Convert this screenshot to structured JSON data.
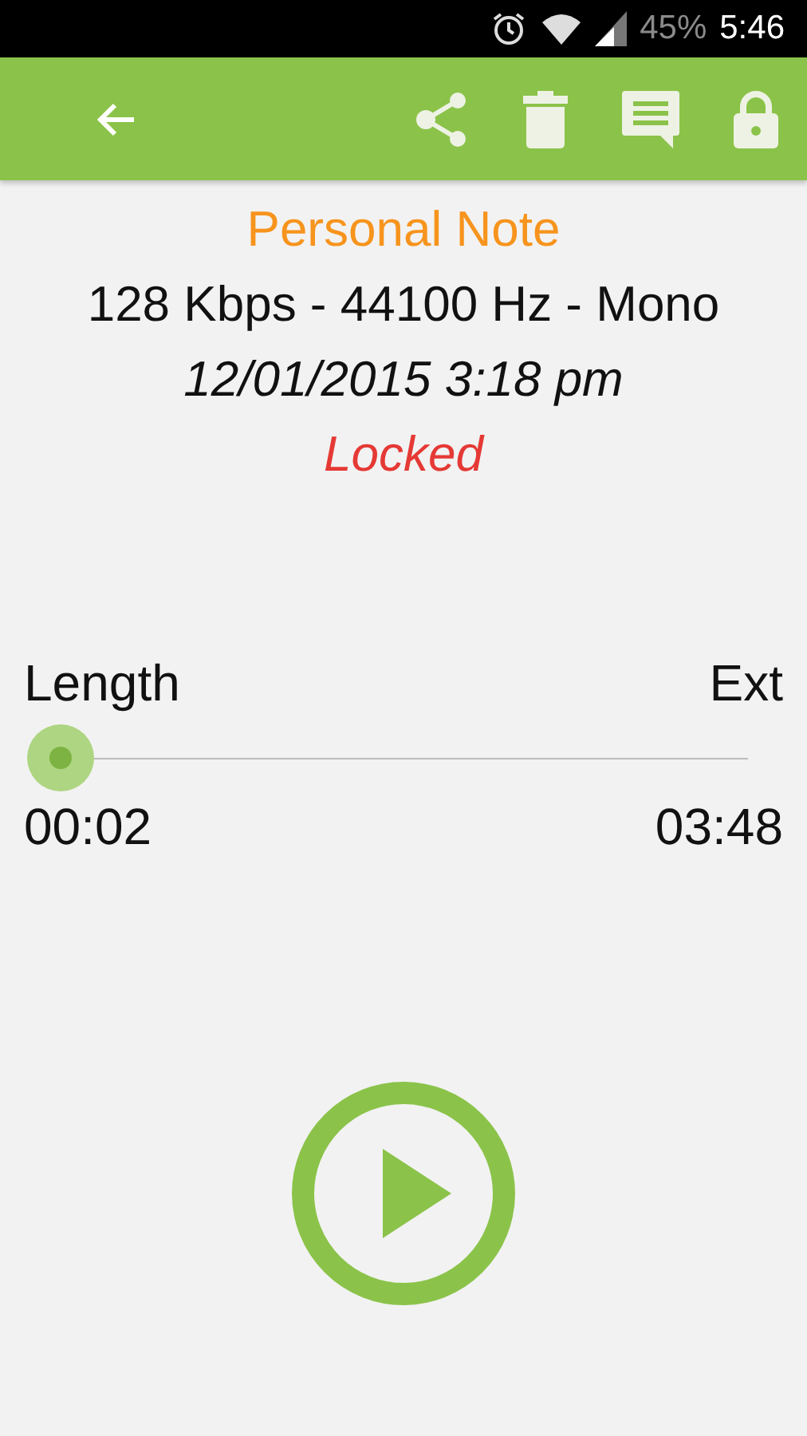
{
  "status_bar": {
    "battery": "45%",
    "time": "5:46"
  },
  "note": {
    "title": "Personal Note",
    "format": "128 Kbps - 44100 Hz - Mono",
    "date": "12/01/2015 3:18 pm",
    "status": "Locked",
    "locked": true
  },
  "seek": {
    "left_label": "Length",
    "right_label": "Ext",
    "elapsed": "00:02",
    "total": "03:48"
  },
  "player": {
    "playing": false
  }
}
